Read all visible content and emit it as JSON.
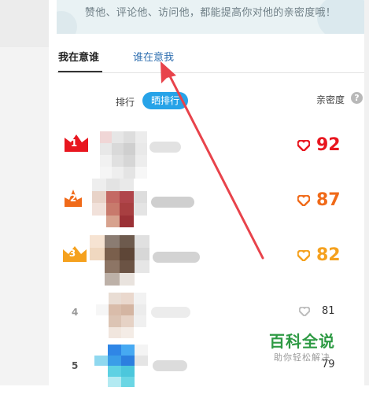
{
  "banner": {
    "text": "赞他、评论他、访问他，都能提高你对他的亲密度哦！"
  },
  "tabs": [
    {
      "label": "我在意谁",
      "active": true
    },
    {
      "label": "谁在意我",
      "active": false
    }
  ],
  "sort": {
    "label": "排行",
    "button": "晒排行"
  },
  "intimacy": {
    "label": "亲密度",
    "help_glyph": "?"
  },
  "ranking": [
    {
      "rank": "1",
      "score": "92",
      "score_color": "#e8161f",
      "crown_color": "#e8161f"
    },
    {
      "rank": "2",
      "score": "87",
      "score_color": "#f06a19",
      "crown_color": "#f06a19"
    },
    {
      "rank": "3",
      "score": "82",
      "score_color": "#f5a11e",
      "crown_color": "#f5a11e"
    },
    {
      "rank": "4",
      "score": "81",
      "score_color": "#333333"
    },
    {
      "rank": "5",
      "score": "79",
      "score_color": "#333333"
    }
  ],
  "watermark": {
    "title": "百科全说",
    "subtitle": "助你轻松解决"
  },
  "colors": {
    "accent": "#27a3e8",
    "arrow": "#e8434b",
    "link": "#2f6fb0"
  }
}
